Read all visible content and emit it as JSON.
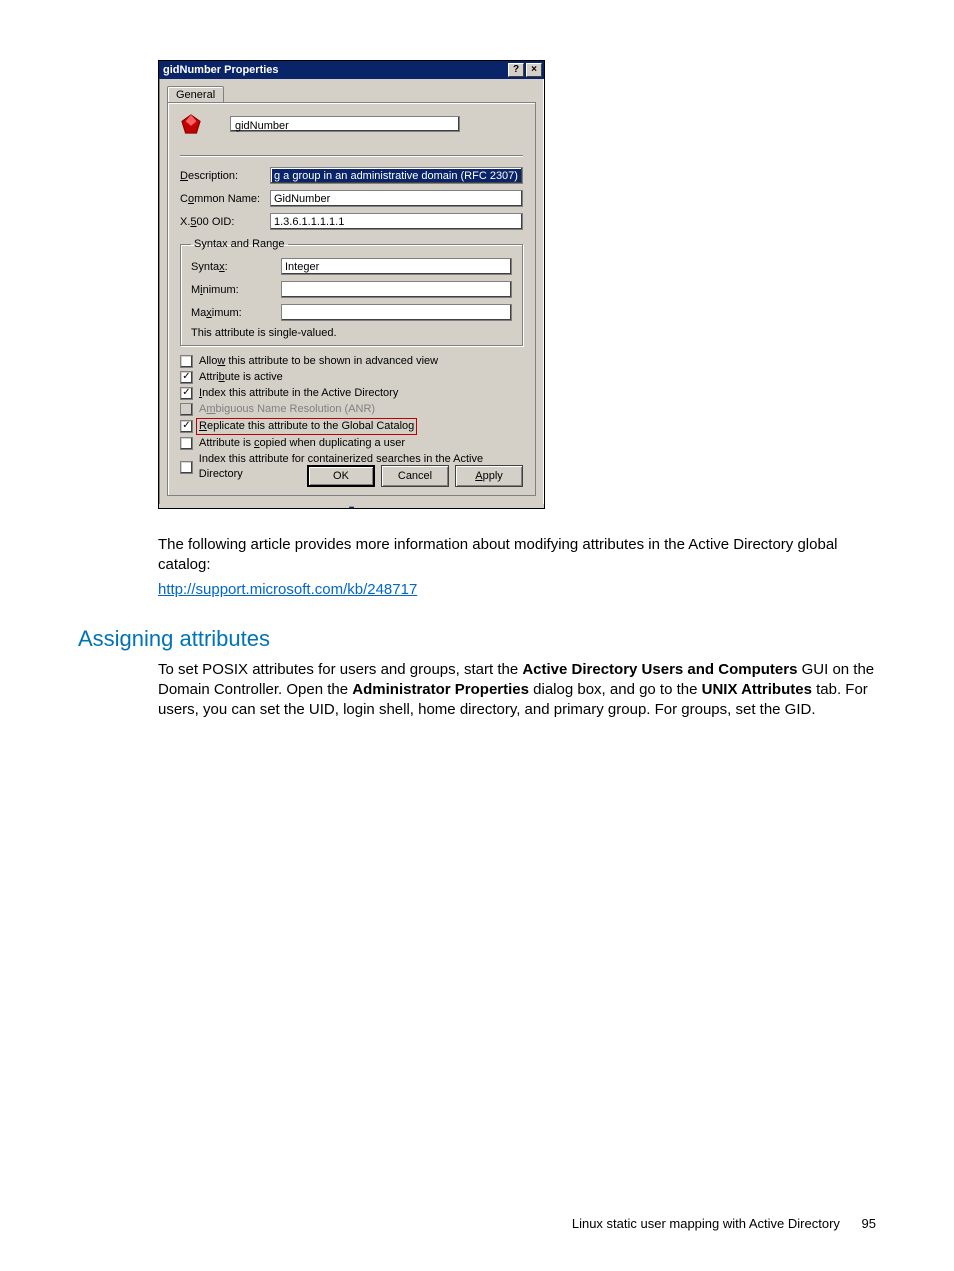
{
  "dialog": {
    "title": "gidNumber Properties",
    "tab": "General",
    "attrName": "gidNumber",
    "fields": {
      "descriptionLabel": "Description:",
      "descriptionValue": "g a group in an administrative domain (RFC 2307)",
      "commonNameLabel": "Common Name:",
      "commonNameValue": "GidNumber",
      "oidLabel": "X.500 OID:",
      "oidValue": "1.3.6.1.1.1.1.1"
    },
    "group": {
      "legend": "Syntax and Range",
      "syntaxLabel": "Syntax:",
      "syntaxValue": "Integer",
      "minLabel": "Minimum:",
      "minValue": "",
      "maxLabel": "Maximum:",
      "maxValue": "",
      "note": "This attribute is single-valued."
    },
    "checks": [
      {
        "label": "Allow this attribute to be shown in advanced view",
        "checked": false,
        "disabled": false,
        "highlight": false
      },
      {
        "label": "Attribute is active",
        "checked": true,
        "disabled": false,
        "highlight": false
      },
      {
        "label": "Index this attribute in the Active Directory",
        "checked": true,
        "disabled": false,
        "highlight": false
      },
      {
        "label": "Ambiguous Name Resolution (ANR)",
        "checked": false,
        "disabled": true,
        "highlight": false
      },
      {
        "label": "Replicate this attribute to the Global Catalog",
        "checked": true,
        "disabled": false,
        "highlight": true
      },
      {
        "label": "Attribute is copied when duplicating a user",
        "checked": false,
        "disabled": false,
        "highlight": false
      },
      {
        "label": "Index this attribute for containerized searches in the Active Directory",
        "checked": false,
        "disabled": false,
        "highlight": false
      }
    ],
    "buttons": {
      "ok": "OK",
      "cancel": "Cancel",
      "apply": "Apply"
    }
  },
  "doc": {
    "para1": "The following article provides more information about modifying attributes in the Active Directory global catalog:",
    "link": "http://support.microsoft.com/kb/248717",
    "heading": "Assigning attributes",
    "para2a": "To set POSIX attributes for users and groups, start the ",
    "bold1": "Active Directory Users and Computers",
    "para2b": " GUI on the Domain Controller. Open the ",
    "bold2": "Administrator Properties",
    "para2c": " dialog box, and go to the ",
    "bold3": "UNIX Attributes",
    "para2d": " tab. For users, you can set the UID, login shell, home directory, and primary group. For groups, set the GID."
  },
  "footer": {
    "text": "Linux static user mapping with Active Directory",
    "page": "95"
  }
}
